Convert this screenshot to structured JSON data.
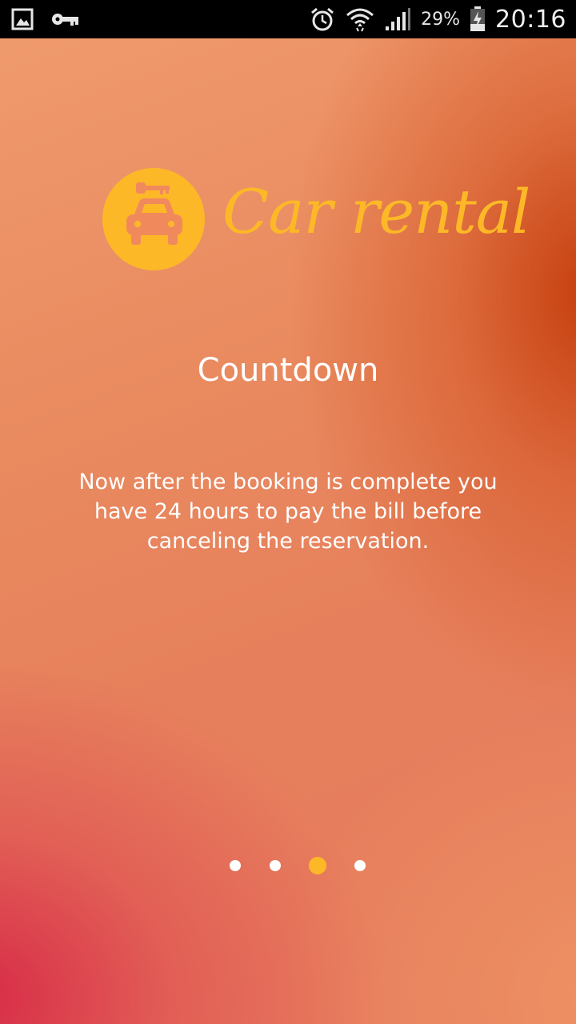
{
  "status_bar": {
    "icons_left": [
      "gallery-icon",
      "key-icon"
    ],
    "icons_right": [
      "alarm-icon",
      "wifi-icon",
      "signal-icon",
      "battery-charging-icon"
    ],
    "battery_percent": "29%",
    "time": "20:16"
  },
  "logo": {
    "icon": "car-key-icon",
    "text": "Car rental"
  },
  "slide": {
    "title": "Countdown",
    "description": "Now after the booking is complete you have 24 hours to pay the bill before canceling the reservation."
  },
  "pager": {
    "count": 4,
    "active_index": 2
  },
  "colors": {
    "accent": "#fdb827",
    "gradient_top": "#ef9a6d",
    "gradient_dark_orange": "#c43a0a",
    "gradient_red": "#d62446",
    "text": "#ffffff"
  }
}
